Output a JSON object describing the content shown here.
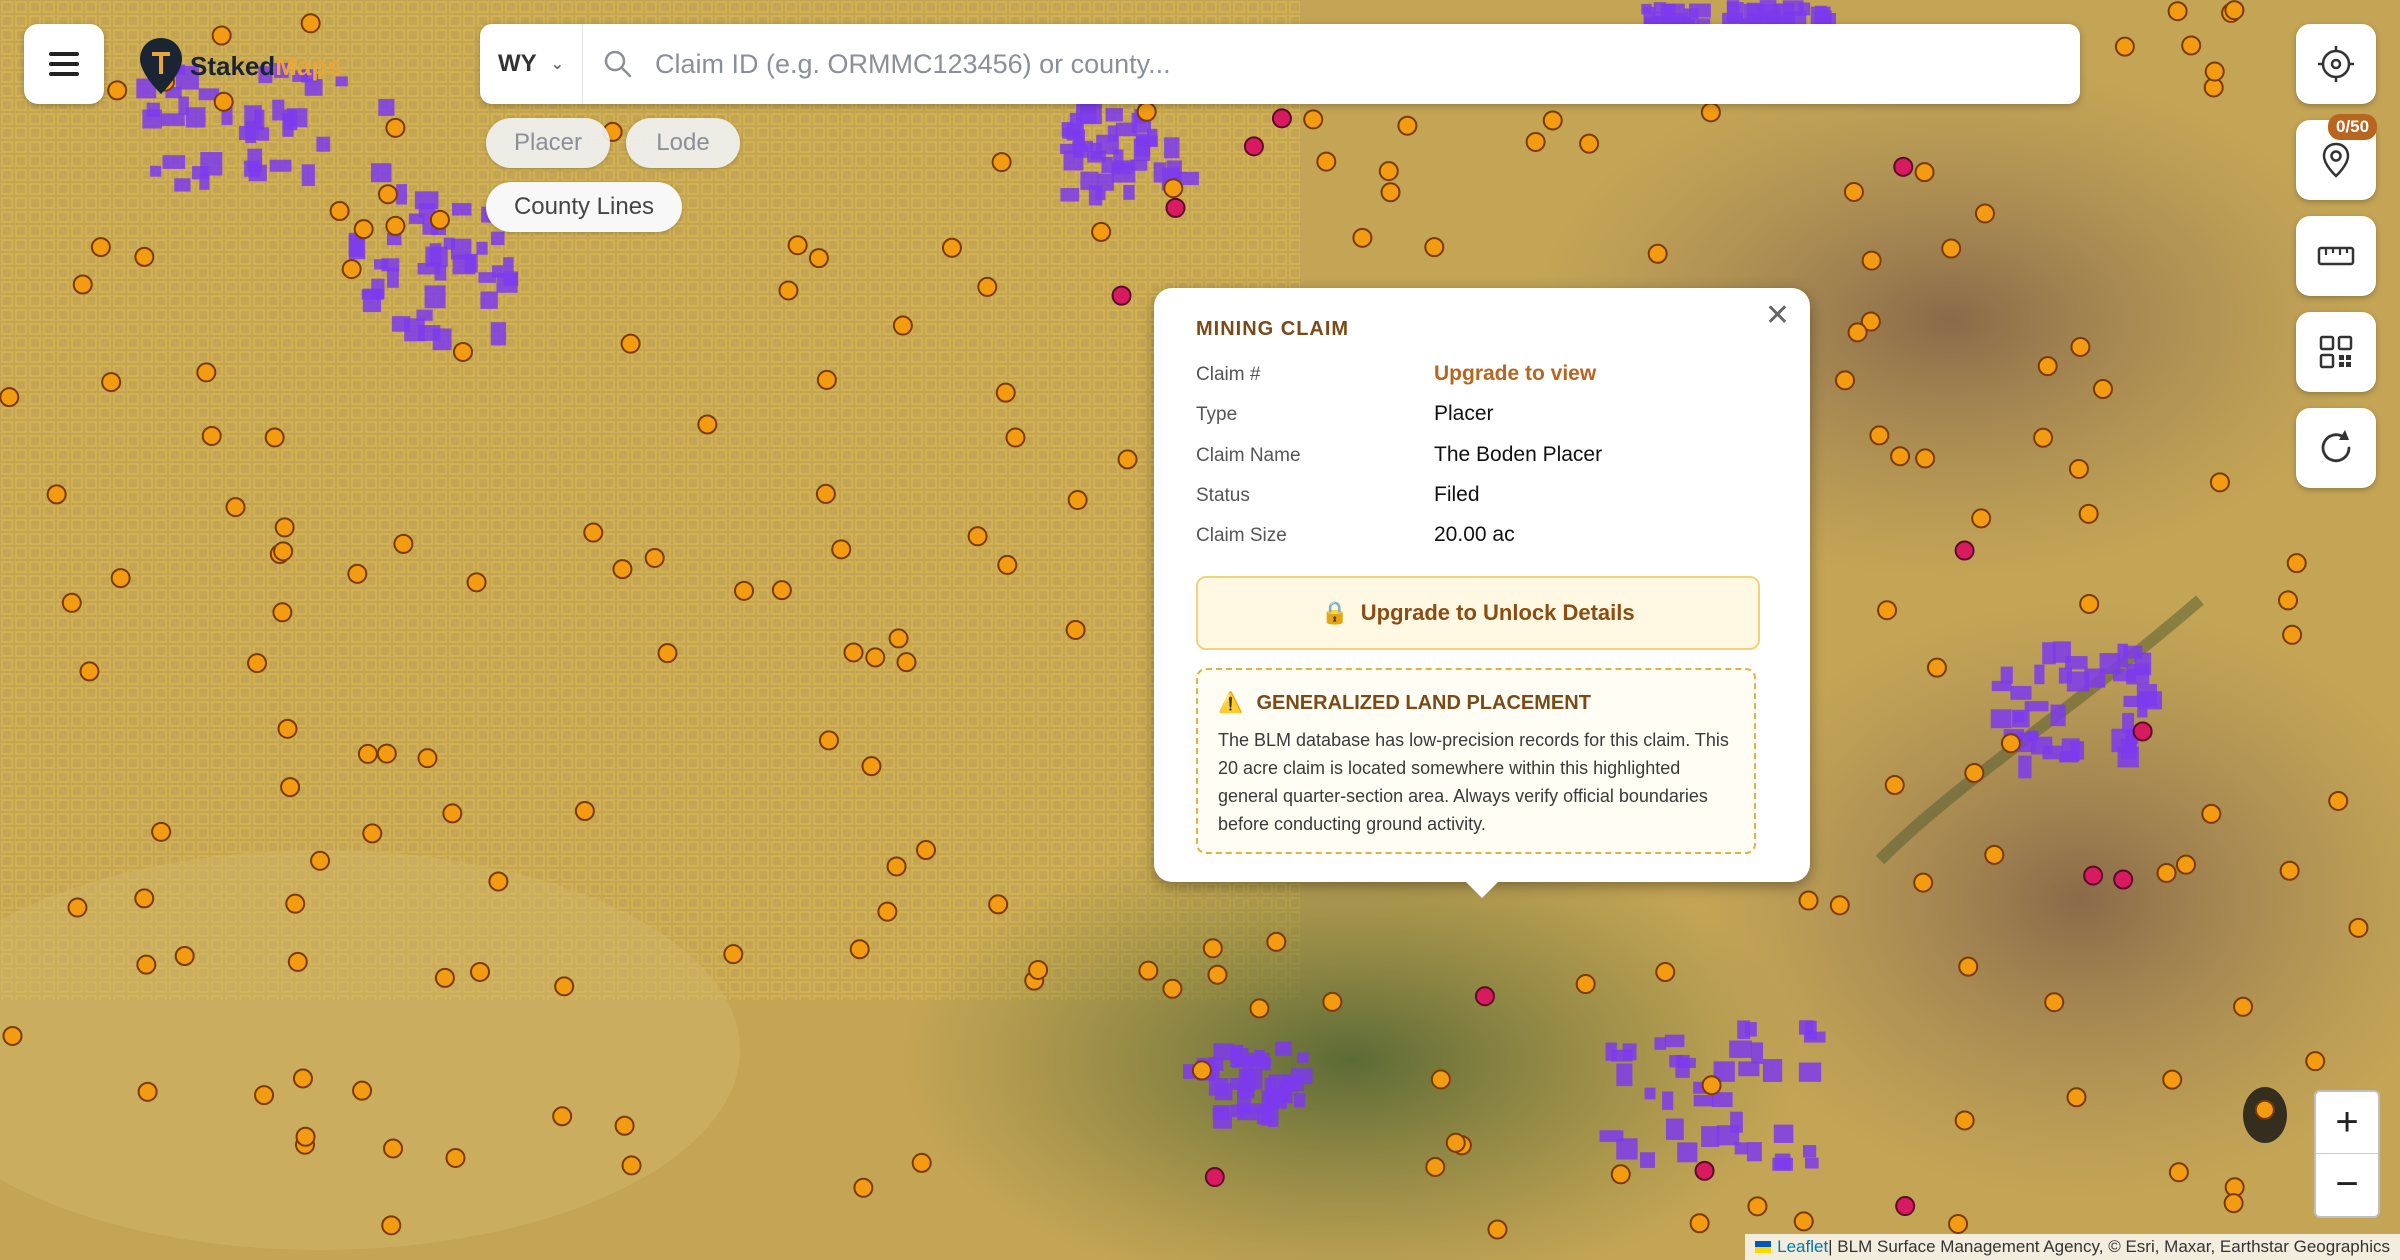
{
  "header": {
    "brand_part1": "Staked",
    "brand_part2": "Maps",
    "state_select": "WY",
    "search_placeholder": "Claim ID (e.g. ORMMC123456) or county..."
  },
  "filters": {
    "chips": [
      "Placer",
      "Lode",
      "County Lines"
    ]
  },
  "tools": {
    "claim_counter": "0/50"
  },
  "popup": {
    "title": "MINING CLAIM",
    "fields": [
      {
        "label": "Claim #",
        "value": "Upgrade to view"
      },
      {
        "label": "Type",
        "value": "Placer"
      },
      {
        "label": "Claim Name",
        "value": "The Boden Placer"
      },
      {
        "label": "Status",
        "value": "Filed"
      },
      {
        "label": "Claim Size",
        "value": "20.00 ac"
      }
    ],
    "unlock_button": "Upgrade to Unlock Details",
    "warning_title": "GENERALIZED LAND PLACEMENT",
    "warning_text": "The BLM database has low-precision records for this claim. This 20 acre claim is located somewhere within this highlighted general quarter-section area. Always verify official boundaries before conducting ground activity."
  },
  "zoom": {
    "in": "+",
    "out": "−"
  },
  "attribution": {
    "leaflet": "Leaflet",
    "text": " | BLM Surface Management Agency, © Esri, Maxar, Earthstar Geographics"
  },
  "colors": {
    "placer_marker": "#f39c12",
    "lode_marker": "#d81b60",
    "claim_block": "#7c3aed",
    "accent": "#b8651f"
  },
  "icons": [
    "menu-icon",
    "map-pin-logo-icon",
    "chevron-down-icon",
    "search-icon",
    "close-icon",
    "lock-icon",
    "warning-icon",
    "locate-icon",
    "pin-icon",
    "ruler-icon",
    "grid-icon",
    "refresh-icon"
  ]
}
